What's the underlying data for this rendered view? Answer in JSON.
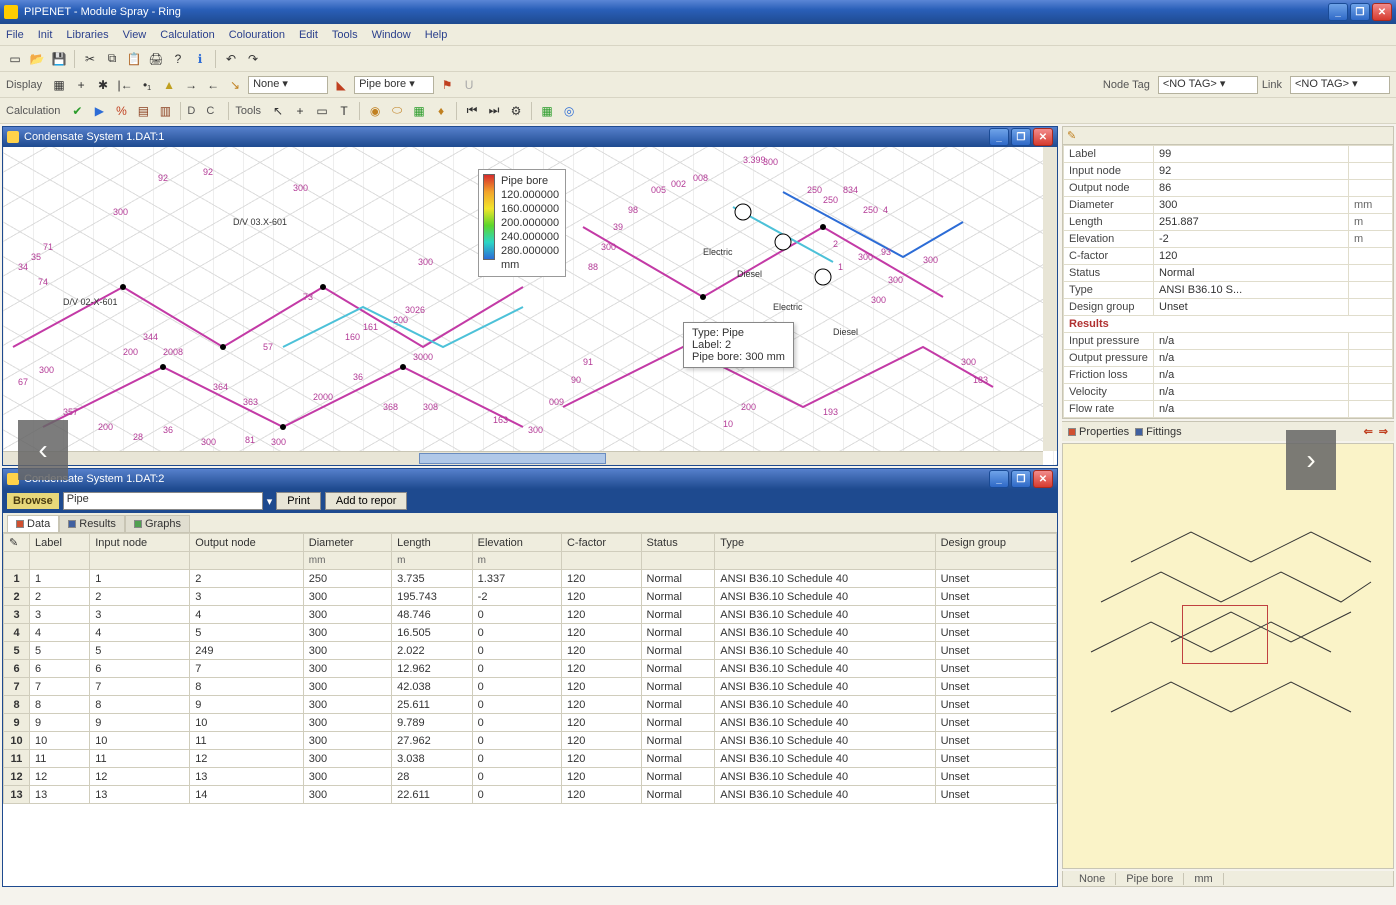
{
  "app": {
    "title": "PIPENET - Module Spray - Ring"
  },
  "menu": [
    "File",
    "Init",
    "Libraries",
    "View",
    "Calculation",
    "Colouration",
    "Edit",
    "Tools",
    "Window",
    "Help"
  ],
  "toolbar2": {
    "display_label": "Display",
    "none_label": "None",
    "pipebore_label": "Pipe bore",
    "nodetag_label": "Node Tag",
    "link_label": "Link",
    "notag": "<NO TAG>"
  },
  "toolbar3": {
    "calc_label": "Calculation",
    "tools_label": "Tools",
    "dc": "D C"
  },
  "mdi1": {
    "title": "Condensate System 1.DAT:1"
  },
  "legend": {
    "title": "Pipe bore",
    "vals": [
      "120.000000",
      "160.000000",
      "200.000000",
      "240.000000",
      "280.000000"
    ],
    "unit": "mm"
  },
  "tooltip": {
    "l1": "Type:  Pipe",
    "l2": "Label: 2",
    "l3": "Pipe bore: 300 mm"
  },
  "diagram_labels": {
    "div1": "D/V 03.X-601",
    "div2": "D/V 02-X-601",
    "electric": "Electric",
    "diesel1": "Diesel",
    "diesel2": "Diesel",
    "electric2": "Electric"
  },
  "mdi2": {
    "title": "Condensate System 1.DAT:2"
  },
  "browser": {
    "label": "Browse",
    "value": "Pipe",
    "print": "Print",
    "add": "Add to repor"
  },
  "subtabs": [
    "Data",
    "Results",
    "Graphs"
  ],
  "columns": [
    "Label",
    "Input node",
    "Output node",
    "Diameter",
    "Length",
    "Elevation",
    "C-factor",
    "Status",
    "Type",
    "Design group"
  ],
  "subcols": [
    "",
    "",
    "",
    "mm",
    "m",
    "m",
    "",
    "",
    "",
    ""
  ],
  "rows": [
    {
      "n": 1,
      "label": "1",
      "in": "1",
      "out": "2",
      "dia": "250",
      "len": "3.735",
      "elev": "1.337",
      "c": "120",
      "status": "Normal",
      "type": "ANSI B36.10 Schedule 40",
      "dg": "Unset"
    },
    {
      "n": 2,
      "label": "2",
      "in": "2",
      "out": "3",
      "dia": "300",
      "len": "195.743",
      "elev": "-2",
      "c": "120",
      "status": "Normal",
      "type": "ANSI B36.10 Schedule 40",
      "dg": "Unset"
    },
    {
      "n": 3,
      "label": "3",
      "in": "3",
      "out": "4",
      "dia": "300",
      "len": "48.746",
      "elev": "0",
      "c": "120",
      "status": "Normal",
      "type": "ANSI B36.10 Schedule 40",
      "dg": "Unset"
    },
    {
      "n": 4,
      "label": "4",
      "in": "4",
      "out": "5",
      "dia": "300",
      "len": "16.505",
      "elev": "0",
      "c": "120",
      "status": "Normal",
      "type": "ANSI B36.10 Schedule 40",
      "dg": "Unset"
    },
    {
      "n": 5,
      "label": "5",
      "in": "5",
      "out": "249",
      "dia": "300",
      "len": "2.022",
      "elev": "0",
      "c": "120",
      "status": "Normal",
      "type": "ANSI B36.10 Schedule 40",
      "dg": "Unset"
    },
    {
      "n": 6,
      "label": "6",
      "in": "6",
      "out": "7",
      "dia": "300",
      "len": "12.962",
      "elev": "0",
      "c": "120",
      "status": "Normal",
      "type": "ANSI B36.10 Schedule 40",
      "dg": "Unset"
    },
    {
      "n": 7,
      "label": "7",
      "in": "7",
      "out": "8",
      "dia": "300",
      "len": "42.038",
      "elev": "0",
      "c": "120",
      "status": "Normal",
      "type": "ANSI B36.10 Schedule 40",
      "dg": "Unset"
    },
    {
      "n": 8,
      "label": "8",
      "in": "8",
      "out": "9",
      "dia": "300",
      "len": "25.611",
      "elev": "0",
      "c": "120",
      "status": "Normal",
      "type": "ANSI B36.10 Schedule 40",
      "dg": "Unset"
    },
    {
      "n": 9,
      "label": "9",
      "in": "9",
      "out": "10",
      "dia": "300",
      "len": "9.789",
      "elev": "0",
      "c": "120",
      "status": "Normal",
      "type": "ANSI B36.10 Schedule 40",
      "dg": "Unset"
    },
    {
      "n": 10,
      "label": "10",
      "in": "10",
      "out": "11",
      "dia": "300",
      "len": "27.962",
      "elev": "0",
      "c": "120",
      "status": "Normal",
      "type": "ANSI B36.10 Schedule 40",
      "dg": "Unset"
    },
    {
      "n": 11,
      "label": "11",
      "in": "11",
      "out": "12",
      "dia": "300",
      "len": "3.038",
      "elev": "0",
      "c": "120",
      "status": "Normal",
      "type": "ANSI B36.10 Schedule 40",
      "dg": "Unset"
    },
    {
      "n": 12,
      "label": "12",
      "in": "12",
      "out": "13",
      "dia": "300",
      "len": "28",
      "elev": "0",
      "c": "120",
      "status": "Normal",
      "type": "ANSI B36.10 Schedule 40",
      "dg": "Unset"
    },
    {
      "n": 13,
      "label": "13",
      "in": "13",
      "out": "14",
      "dia": "300",
      "len": "22.611",
      "elev": "0",
      "c": "120",
      "status": "Normal",
      "type": "ANSI B36.10 Schedule 40",
      "dg": "Unset"
    }
  ],
  "props": {
    "rows": [
      {
        "k": "Label",
        "v": "99",
        "u": ""
      },
      {
        "k": "Input node",
        "v": "92",
        "u": ""
      },
      {
        "k": "Output node",
        "v": "86",
        "u": ""
      },
      {
        "k": "Diameter",
        "v": "300",
        "u": "mm"
      },
      {
        "k": "Length",
        "v": "251.887",
        "u": "m"
      },
      {
        "k": "Elevation",
        "v": "-2",
        "u": "m"
      },
      {
        "k": "C-factor",
        "v": "120",
        "u": ""
      },
      {
        "k": "Status",
        "v": "Normal",
        "u": ""
      },
      {
        "k": "Type",
        "v": "ANSI B36.10 S...",
        "u": ""
      },
      {
        "k": "Design group",
        "v": "Unset",
        "u": ""
      }
    ],
    "section": "Results",
    "results": [
      {
        "k": "Input pressure",
        "v": "n/a"
      },
      {
        "k": "Output pressure",
        "v": "n/a"
      },
      {
        "k": "Friction loss",
        "v": "n/a"
      },
      {
        "k": "Velocity",
        "v": "n/a"
      },
      {
        "k": "Flow rate",
        "v": "n/a"
      }
    ],
    "tabs": [
      "Properties",
      "Fittings"
    ]
  },
  "status": {
    "c1": "None",
    "c2": "Pipe bore",
    "c3": "mm"
  }
}
